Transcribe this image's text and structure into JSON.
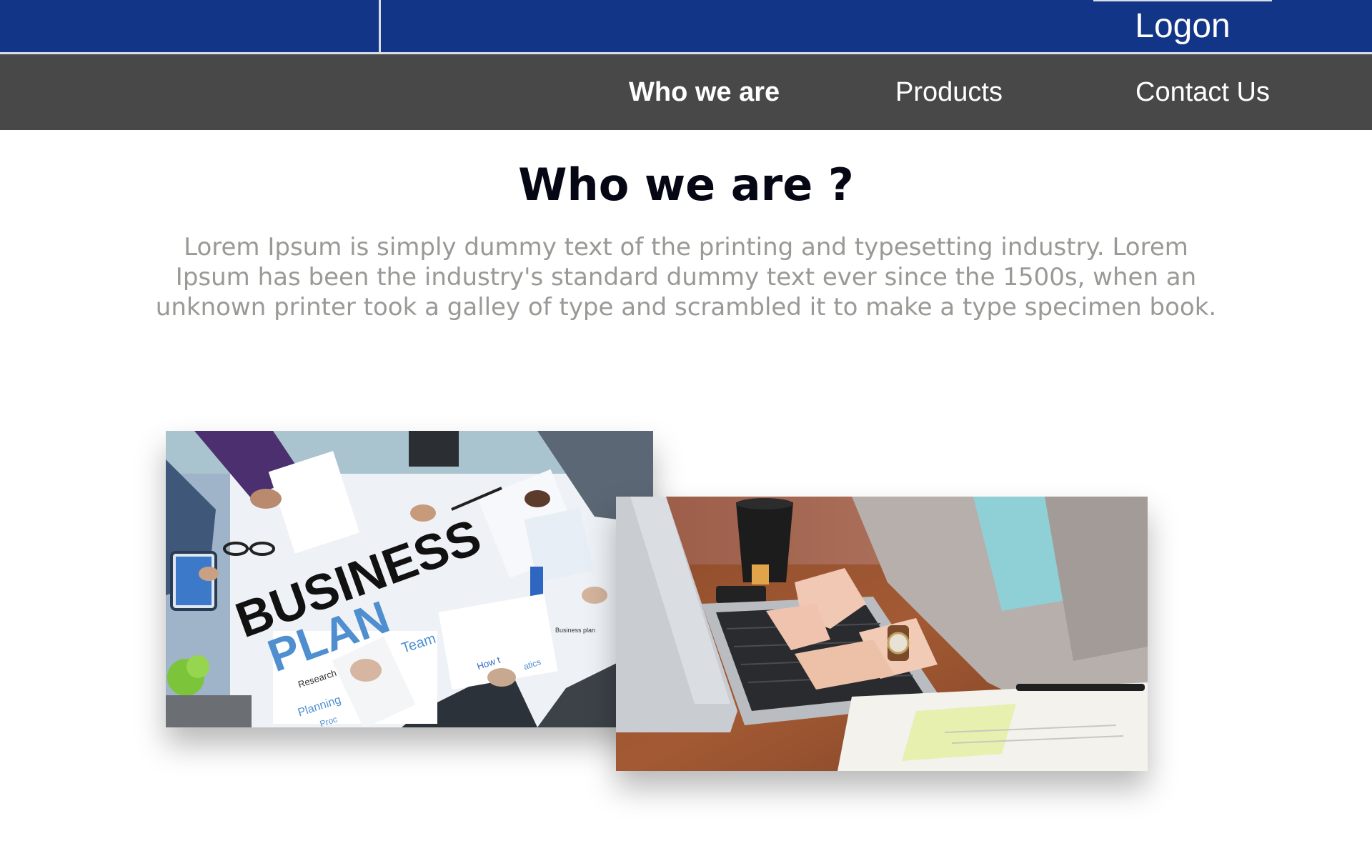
{
  "header": {
    "logon_label": "Logon"
  },
  "nav": {
    "items": [
      {
        "label": "Who we are",
        "active": true
      },
      {
        "label": "Products",
        "active": false
      },
      {
        "label": "Contact Us",
        "active": false
      }
    ]
  },
  "main": {
    "title": "Who we are ?",
    "intro": "Lorem Ipsum is simply dummy text of the printing and typesetting industry. Lorem Ipsum has been the industry's standard dummy text ever since the 1500s, when an unknown printer took a galley of type and scrambled it to make a type specimen book."
  },
  "images": {
    "business_plan": {
      "word1": "BUSINESS",
      "word2": "PLAN",
      "labels": [
        "Team",
        "Research",
        "Planning",
        "Proc",
        "How t",
        "atics",
        "Business plan"
      ]
    },
    "laptop": {}
  },
  "colors": {
    "topbar": "#123588",
    "navbar": "#484848",
    "title": "#050714",
    "intro": "#999a96"
  }
}
